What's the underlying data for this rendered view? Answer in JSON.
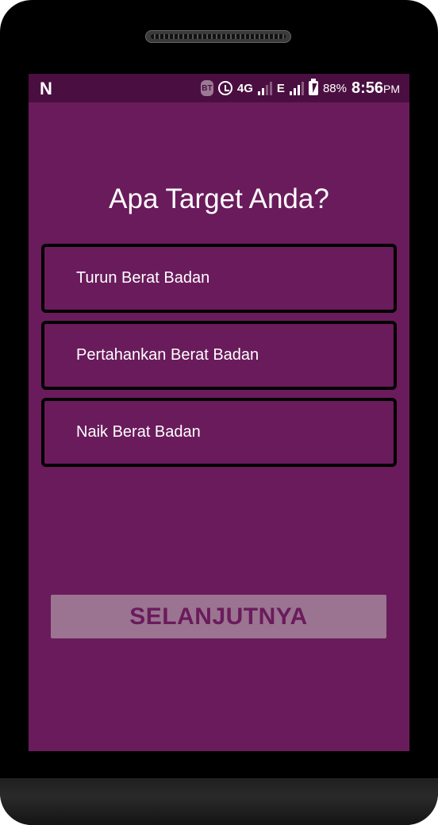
{
  "status_bar": {
    "notification_icon": "N",
    "bt_icon_text": "BT",
    "network_4g": "4G",
    "network_e": "E",
    "battery_percent": "88%",
    "time": "8:56",
    "time_suffix": "PM"
  },
  "page": {
    "title": "Apa Target Anda?",
    "options": [
      {
        "label": "Turun Berat Badan"
      },
      {
        "label": "Pertahankan Berat Badan"
      },
      {
        "label": "Naik Berat Badan"
      }
    ],
    "next_button_label": "SELANJUTNYA"
  },
  "colors": {
    "background": "#6a1b5c",
    "status_bar": "#4a0f40",
    "button_disabled": "#9b7491",
    "option_border": "#000000"
  }
}
